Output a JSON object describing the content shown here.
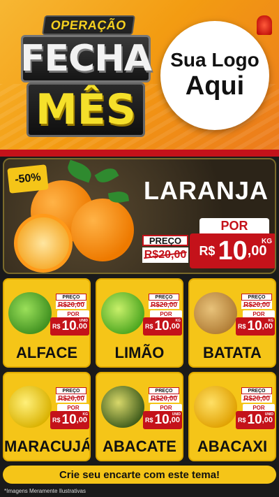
{
  "header": {
    "operation_label": "OPERAÇÃO",
    "title_line1": "FECHA",
    "title_line2": "MÊS",
    "logo_line1": "Sua Logo",
    "logo_line2": "Aqui"
  },
  "featured": {
    "discount": "-50%",
    "name": "LARANJA",
    "preco_label": "PREÇO",
    "old_price": "R$20,00",
    "por_label": "POR",
    "currency": "R$",
    "price_int": "10",
    "price_dec": ",00",
    "unit": "KG"
  },
  "products": [
    {
      "name": "ALFACE",
      "preco_label": "PREÇO",
      "old_price": "R$20,00",
      "por_label": "POR",
      "currency": "R$",
      "price_int": "10",
      "price_dec": ",00",
      "unit": "UNID"
    },
    {
      "name": "LIMÃO",
      "preco_label": "PREÇO",
      "old_price": "R$20,00",
      "por_label": "POR",
      "currency": "R$",
      "price_int": "10",
      "price_dec": ",00",
      "unit": "KG"
    },
    {
      "name": "BATATA",
      "preco_label": "PREÇO",
      "old_price": "R$20,00",
      "por_label": "POR",
      "currency": "R$",
      "price_int": "10",
      "price_dec": ",00",
      "unit": "KG"
    },
    {
      "name": "MARACUJÁ",
      "preco_label": "PREÇO",
      "old_price": "R$20,00",
      "por_label": "POR",
      "currency": "R$",
      "price_int": "10",
      "price_dec": ",00",
      "unit": "KG"
    },
    {
      "name": "ABACATE",
      "preco_label": "PREÇO",
      "old_price": "R$20,00",
      "por_label": "POR",
      "currency": "R$",
      "price_int": "10",
      "price_dec": ",00",
      "unit": "UNID"
    },
    {
      "name": "ABACAXI",
      "preco_label": "PREÇO",
      "old_price": "R$20,00",
      "por_label": "POR",
      "currency": "R$",
      "price_int": "10",
      "price_dec": ",00",
      "unit": "UNID"
    }
  ],
  "footer": {
    "cta": "Crie seu encarte com este tema!",
    "disclaimer": "*Imagens Meramente Ilustrativas"
  },
  "colors": {
    "accent_yellow": "#f5c518",
    "price_red": "#c4121a",
    "header_orange": "#f39c12"
  }
}
